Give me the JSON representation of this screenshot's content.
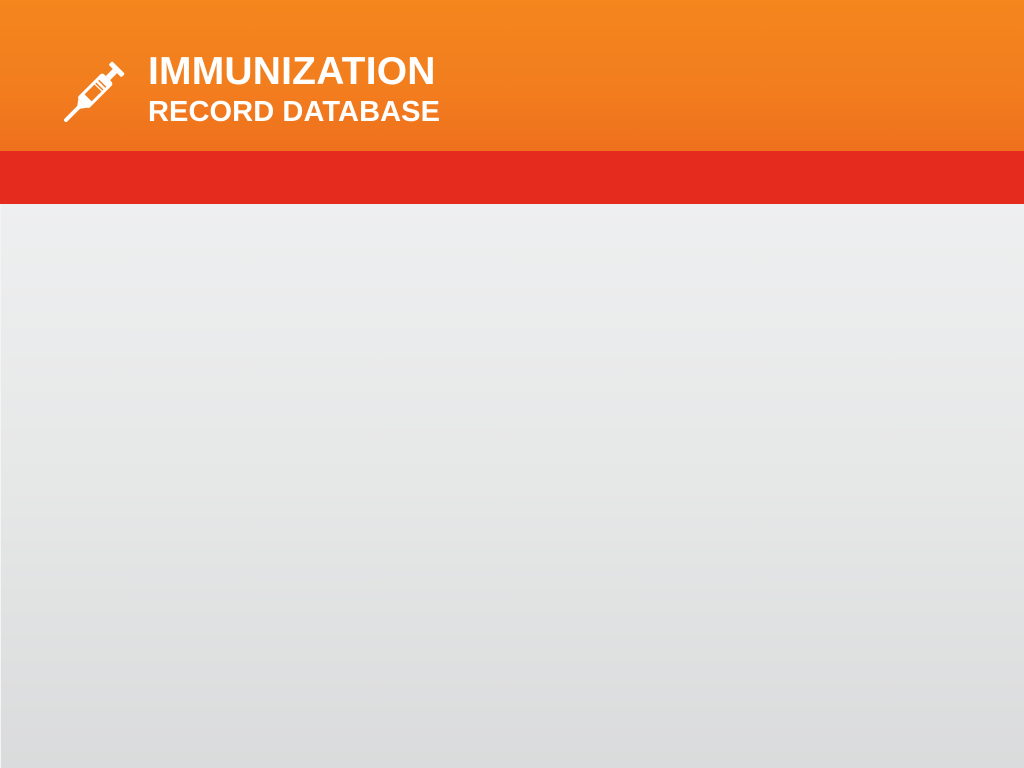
{
  "header": {
    "logo_icon": "syringe-icon",
    "title_line1": "IMMUNIZATION",
    "title_line2": "RECORD DATABASE"
  },
  "colors": {
    "header_orange": "#f4861d",
    "band_red": "#e52b1e",
    "content_gray": "#e6e7e7",
    "text_white": "#ffffff"
  }
}
